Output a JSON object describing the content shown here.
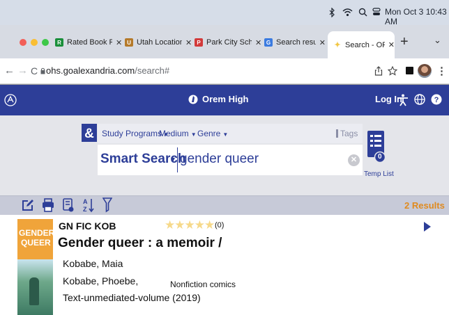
{
  "menubar": {
    "clock": "Mon Oct 3  10:43 AM"
  },
  "tabs": [
    {
      "label": "Rated Book Revie",
      "favicon_color": "#1a8f3a",
      "favicon_text": "R"
    },
    {
      "label": "Utah Locations | F",
      "favicon_color": "#b57a2a",
      "favicon_text": "U"
    },
    {
      "label": "Park City School D",
      "favicon_color": "#d23a3a",
      "favicon_text": "P"
    },
    {
      "label": "Search results - G",
      "favicon_color": "#3b7be0",
      "favicon_text": "G"
    },
    {
      "label": "Search - OREMHS",
      "favicon_color": "#f2c744",
      "favicon_text": "",
      "active": true
    }
  ],
  "browser": {
    "new_tab": "+",
    "tab_menu": "⌄",
    "back": "←",
    "forward": "→",
    "reload": "C",
    "url_domain": "ohs.goalexandria.com",
    "url_path": "/search#"
  },
  "site": {
    "school_name": "Orem High",
    "login_label": "Log In"
  },
  "search": {
    "filters": [
      "Study Programs",
      "Medium",
      "Genre"
    ],
    "tags_label": "Tags",
    "smart_search_label": "Smart Search",
    "query": "gender queer",
    "temp_list_label": "Temp List",
    "temp_list_count": "0"
  },
  "toolbar": {
    "results_count": "2 Results"
  },
  "result": {
    "call_number": "GN FIC KOB",
    "rating_count": "(0)",
    "rating": 0,
    "title": "Gender queer : a memoir /",
    "authors": [
      "Kobabe, Maia",
      "Kobabe, Phoebe,"
    ],
    "format": "Text-unmediated-volume (2019)",
    "genre": "Nonfiction comics",
    "cover_lines": [
      "GENDER",
      "QUEER"
    ]
  },
  "colors": {
    "brand_blue": "#2d3e98",
    "results_orange": "#e08a1e",
    "star_empty": "#f6d98a"
  }
}
